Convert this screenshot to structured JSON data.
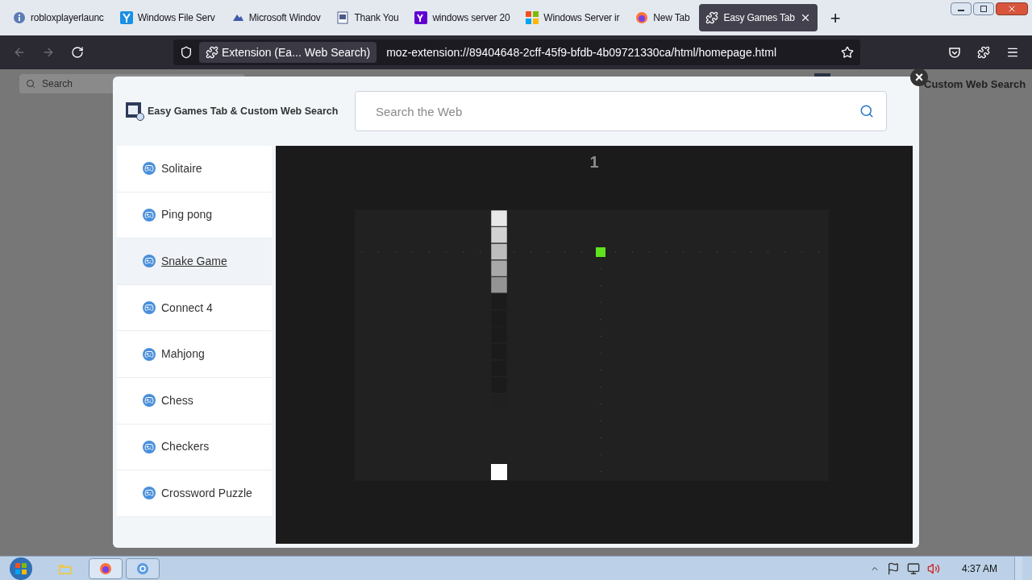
{
  "browser_tabs": [
    {
      "title": "robloxplayerlaunc",
      "selected": false
    },
    {
      "title": "Windows File Serv",
      "selected": false
    },
    {
      "title": "Microsoft Windov",
      "selected": false
    },
    {
      "title": "Thank You",
      "selected": false
    },
    {
      "title": "windows server 20",
      "selected": false
    },
    {
      "title": "Windows Server ir",
      "selected": false
    },
    {
      "title": "New Tab",
      "selected": false
    },
    {
      "title": "Easy Games Tab",
      "selected": true
    }
  ],
  "new_tab": "+",
  "address_bar": {
    "identity": "Extension (Ea... Web Search)",
    "url": "moz-extension://89404648-2cff-45f9-bfdb-4b09721330ca/html/homepage.html"
  },
  "background_page": {
    "search_placeholder": "Search",
    "title": "Custom Web Search"
  },
  "modal": {
    "close": "×",
    "title": "Easy Games Tab & Custom Web Search",
    "search_placeholder": "Search the Web",
    "games": [
      {
        "label": "Solitaire",
        "selected": false
      },
      {
        "label": "Ping pong",
        "selected": false
      },
      {
        "label": "Snake Game",
        "selected": true
      },
      {
        "label": "Connect 4",
        "selected": false
      },
      {
        "label": "Mahjong",
        "selected": false
      },
      {
        "label": "Chess",
        "selected": false
      },
      {
        "label": "Checkers",
        "selected": false
      },
      {
        "label": "Crossword Puzzle",
        "selected": false
      }
    ],
    "score": "1"
  },
  "taskbar": {
    "clock": "4:37 AM"
  }
}
